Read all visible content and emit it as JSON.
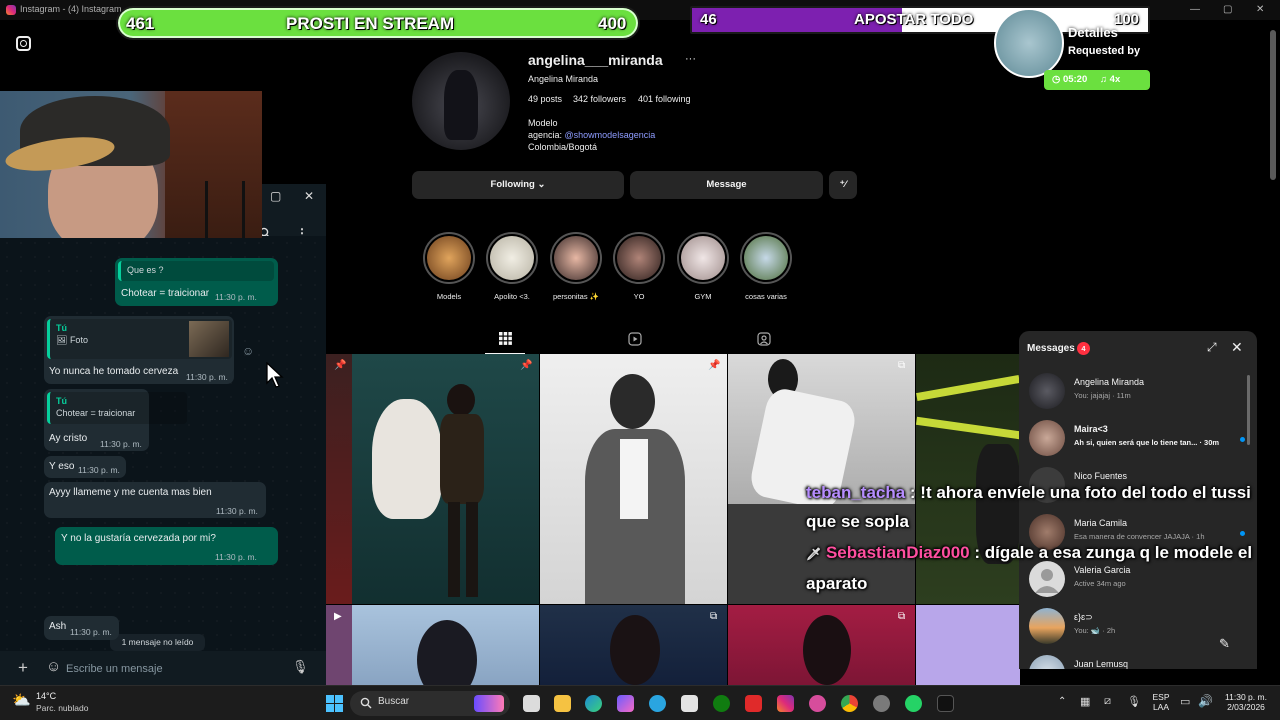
{
  "window": {
    "title": "Instagram - (4) Instagram"
  },
  "stream": {
    "left_bar": {
      "left_count": "461",
      "label": "PROSTI EN STREAM",
      "right_count": "400"
    },
    "right_bar": {
      "left_count": "46",
      "label": "APOSTAR TODO",
      "right_count": "100"
    },
    "request": {
      "title": "Detalles",
      "requested_by": "Requested by",
      "timer": "05:20",
      "multiplier": "4x"
    },
    "chat": [
      {
        "user": "teban_tacha",
        "text": " : !t ahora envíele una foto del todo el tussi que se sopla"
      },
      {
        "user": "SebastianDiaz000",
        "text": " : dígale a esa zunga q le modele el aparato"
      }
    ]
  },
  "whatsapp": {
    "messages": [
      {
        "type": "quote",
        "who": "Que es ?",
        "quote_text": "",
        "text": "Chotear = traicionar",
        "time": "11:30 p. m."
      },
      {
        "type": "quote-photo",
        "who": "Tú",
        "quote_text": "Foto",
        "text": "Yo nunca he tomado cerveza",
        "time": "11:30 p. m."
      },
      {
        "type": "quote",
        "who": "Tú",
        "quote_text": "Chotear = traicionar",
        "text": "Ay cristo",
        "time": "11:30 p. m."
      },
      {
        "type": "plain",
        "text": "Y eso",
        "time": "11:30 p. m."
      },
      {
        "type": "plain",
        "text": "Ayyy llameme y me cuenta mas bien",
        "time": "11:30 p. m."
      },
      {
        "type": "out",
        "text": "Y no la gustaría cervezada por mi?",
        "time": "11:30 p. m."
      },
      {
        "type": "plain",
        "text": "Ash",
        "time": "11:30 p. m."
      }
    ],
    "unread_label": "1 mensaje no leído",
    "input_placeholder": "Escribe un mensaje"
  },
  "profile": {
    "username": "angelina___miranda",
    "full_name": "Angelina Miranda",
    "posts": "49 posts",
    "followers": "342 followers",
    "following": "401 following",
    "bio_line1": "Modelo",
    "bio_line2_prefix": "agencia: ",
    "bio_link": "@showmodelsagencia",
    "bio_line3": "Colombia/Bogotá",
    "btn_following": "Following ⌄",
    "btn_message": "Message",
    "highlights": [
      "Models",
      "Apolito <3.",
      "personitas ✨",
      "YO",
      "GYM",
      "cosas varias"
    ]
  },
  "messages_panel": {
    "title": "Messages",
    "badge": "4",
    "conversations": [
      {
        "name": "Angelina Miranda",
        "preview": "You: jajajaj · 11m",
        "unread": false
      },
      {
        "name": "Maira<3",
        "preview": "Ah si, quien será que lo tiene tan... · 30m",
        "unread": true
      },
      {
        "name": "Nico Fuentes",
        "preview": "",
        "unread": false
      },
      {
        "name": "Maria Camila",
        "preview": "Esa manera de convencer JAJAJA · 1h",
        "unread": true
      },
      {
        "name": "Valeria Garcia",
        "preview": "Active 34m ago",
        "unread": false
      },
      {
        "name": "ε}ɛ⊃",
        "preview": "You: 🐋 · 2h",
        "unread": false
      },
      {
        "name": "Juan Lemusq",
        "preview": "",
        "unread": false
      }
    ]
  },
  "taskbar": {
    "weather_temp": "14°C",
    "weather_desc": "Parc. nublado",
    "search_placeholder": "Buscar",
    "lang": "ESP",
    "lang2": "LAA",
    "time": "11:30 p. m.",
    "date": "2/03/2026"
  },
  "colors": {
    "green_bar": "#6be03f",
    "purple_bar": "#7d20b0",
    "wa_out": "#005c4b",
    "ig_link": "#8e9cff"
  }
}
